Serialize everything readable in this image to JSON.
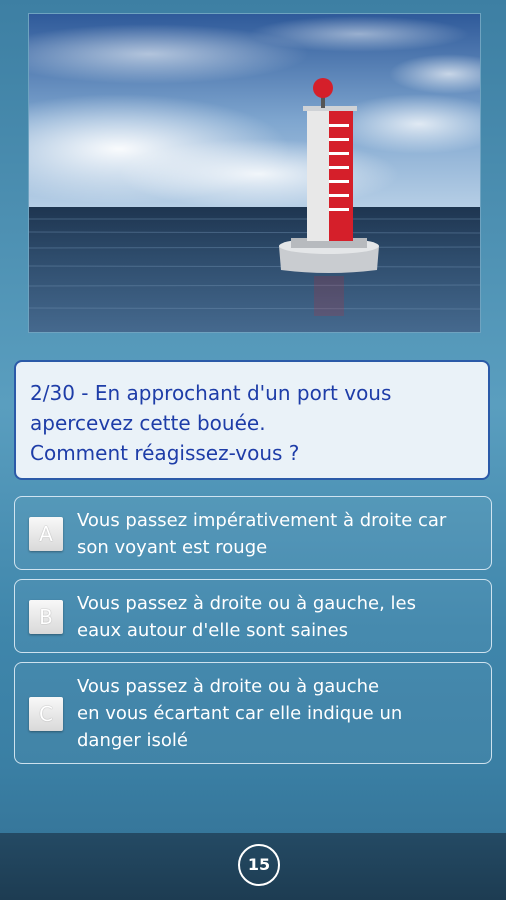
{
  "question": {
    "lines": [
      "2/30 - En approchant d'un port vous",
      "apercevez cette bouée.",
      "Comment réagissez-vous ?"
    ]
  },
  "answers": [
    {
      "letter": "A",
      "lines": [
        "Vous passez impérativement à droite car",
        "son voyant est rouge"
      ]
    },
    {
      "letter": "B",
      "lines": [
        "Vous passez à droite ou à gauche, les",
        "eaux autour d'elle sont saines"
      ]
    },
    {
      "letter": "C",
      "lines": [
        "Vous passez à droite ou à gauche",
        "en vous écartant car elle indique un",
        "danger isolé"
      ]
    }
  ],
  "timer": {
    "value": "15"
  },
  "colors": {
    "question_text": "#1e3da8",
    "question_border": "#2b5aa8",
    "buoy": "#d51f2a"
  }
}
